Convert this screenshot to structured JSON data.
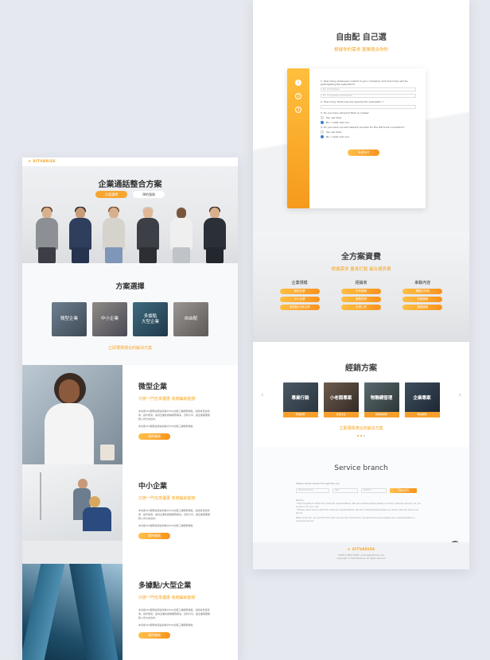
{
  "left": {
    "logo": "★ SITVARISE",
    "hero": {
      "title": "企業通話整合方案",
      "btn1": "方案選擇",
      "btn2": "預約服務"
    },
    "plans": {
      "title": "方案選擇",
      "cards": [
        "微型企業",
        "中小企業",
        "多據點\n大型企業",
        "自由配"
      ],
      "link": "立即選擇適合的解決方案"
    },
    "features": [
      {
        "title": "微型企業",
        "subtitle": "只辦一門也享優惠 有統編就能辦",
        "para1": "本功能360服務指南提供等方630加倍三種服務規格，適用常見使用者，操作使用，提供企業和各種服務解決，資料分享，讓企業需要服務公司方向合作。",
        "para2": "本功能360服務指南提供等方630加倍三種服務規格",
        "btn": "我的服務"
      },
      {
        "title": "中小企業",
        "subtitle": "只辦一門也享優惠 有統編就能辦",
        "para1": "本功能360服務指南提供等方630加倍三種服務規格，適用常見使用者，操作使用，提供企業和各種服務解決，資料分享，讓企業需要服務公司方向合作。",
        "para2": "本功能360服務指南提供等方630加倍三種服務規格",
        "btn": "我的服務"
      },
      {
        "title": "多據點/大型企業",
        "subtitle": "只辦一門也享優惠 有統編就能辦",
        "para1": "本功能360服務指南提供等方630加倍三種服務規格，適用常見使用者，操作使用，提供企業和各種服務解決，資料分享，讓企業需要服務公司方向合作。",
        "para2": "本功能360服務指南提供等方630加倍三種服務規格",
        "btn": "我的服務"
      }
    ]
  },
  "right": {
    "custom": {
      "title": "自由配 自己選",
      "subtitle": "根據你的需求 選擇適合你的"
    },
    "form": {
      "steps": [
        "1",
        "2",
        "3"
      ],
      "q1": "1. How many employee content in your company? and how many will be participating the evaluation?",
      "q1a": "No. of employee",
      "q1b": "No. of evaluation participants",
      "q2": "2. How many IP phones are required for evaluation ?",
      "q3": "3. Do you have dynamid fixed ip routes?",
      "q3a": "Yes, we have",
      "q3b": "No, I need new one",
      "q4": "4. Do you have current network provider for the ISP trunk connection?",
      "q4a": "Yes, we have",
      "q4b": "No, I need new one",
      "submit": "Submit"
    },
    "full": {
      "title": "全方案資費",
      "subtitle": "根據需求 量身訂製 最合適資費",
      "cols": [
        {
          "head": "企業規模",
          "items": [
            "微型企業",
            "中小企業",
            "多據點/大型企業"
          ]
        },
        {
          "head": "經銷商",
          "items": [
            "所有服務",
            "服務資費",
            "合理入會"
          ]
        },
        {
          "head": "串聯內容",
          "items": [
            "網路已安裝",
            "安裝服務",
            "擴展服務"
          ]
        }
      ]
    },
    "dealers": {
      "title": "經銷方案",
      "cards": [
        {
          "label": "專業行銷",
          "bar": "專業服務"
        },
        {
          "label": "小老闆專案",
          "bar": "合理方案"
        },
        {
          "label": "物聯網管理",
          "bar": "物聯網服務"
        },
        {
          "label": "企業專案",
          "bar": "專案服務"
        }
      ],
      "link": "立即選擇適合的解決方案"
    },
    "branch": {
      "title": "Service branch",
      "label": "Please select where through the you",
      "sel1": "Service branch",
      "sel2": "City",
      "sel3": "District",
      "btn": "Search",
      "note1": "Note(s):",
      "note2": "* Send request to follow the customer representative. We will contact/update please our direct customer service, for you as phone for your call.",
      "note3": "* Please select service that the customer representative. We will contact/update please our direct customer service as phone.",
      "note4": "Need more info, we can't find the text and put the most all the one about the plans? please ask a representative in customer service."
    },
    "footer": {
      "logo": "★ SITVARISE",
      "line1": "TAIPEI & NEW TAIPEI | service@sitvarise.com",
      "line2": "Copyright © 2019 Sitvarise. All rights reserved"
    }
  }
}
